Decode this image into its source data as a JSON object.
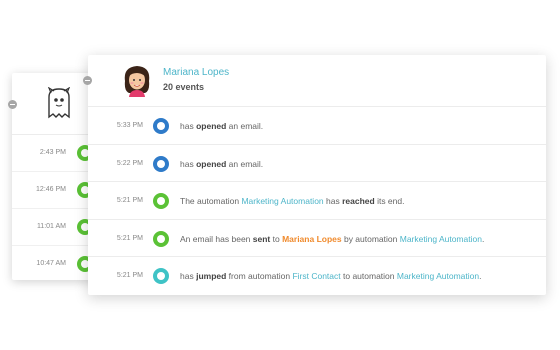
{
  "back_card": {
    "times": [
      "2:43 PM",
      "12:46 PM",
      "11:01 AM",
      "10:47 AM"
    ]
  },
  "front_card": {
    "contact_name": "Mariana Lopes",
    "event_count": "20 events",
    "events": [
      {
        "time": "5:33 PM",
        "type": "email",
        "pre": "has ",
        "verb": "opened",
        "post": " an email."
      },
      {
        "time": "5:22 PM",
        "type": "email",
        "pre": "has ",
        "verb": "opened",
        "post": " an email."
      },
      {
        "time": "5:21 PM",
        "type": "automation",
        "pre": "The automation ",
        "link1": "Marketing Automation",
        "mid": " has ",
        "verb": "reached",
        "post": " its end."
      },
      {
        "time": "5:21 PM",
        "type": "automation",
        "pre": "An email has been ",
        "verb": "sent",
        "mid": " to ",
        "contact": "Mariana Lopes",
        "mid2": " by automation ",
        "link1": "Marketing Automation",
        "post": "."
      },
      {
        "time": "5:21 PM",
        "type": "jump",
        "pre": "has ",
        "verb": "jumped",
        "mid": " from automation ",
        "link1": "First Contact",
        "mid2": " to automation ",
        "link2": "Marketing Automation",
        "post": "."
      }
    ]
  },
  "colors": {
    "accent": "#4db5c9",
    "email": "#2f7bc9",
    "automation": "#5bc236",
    "jump": "#3fc3c6",
    "contact": "#f08a2c"
  }
}
